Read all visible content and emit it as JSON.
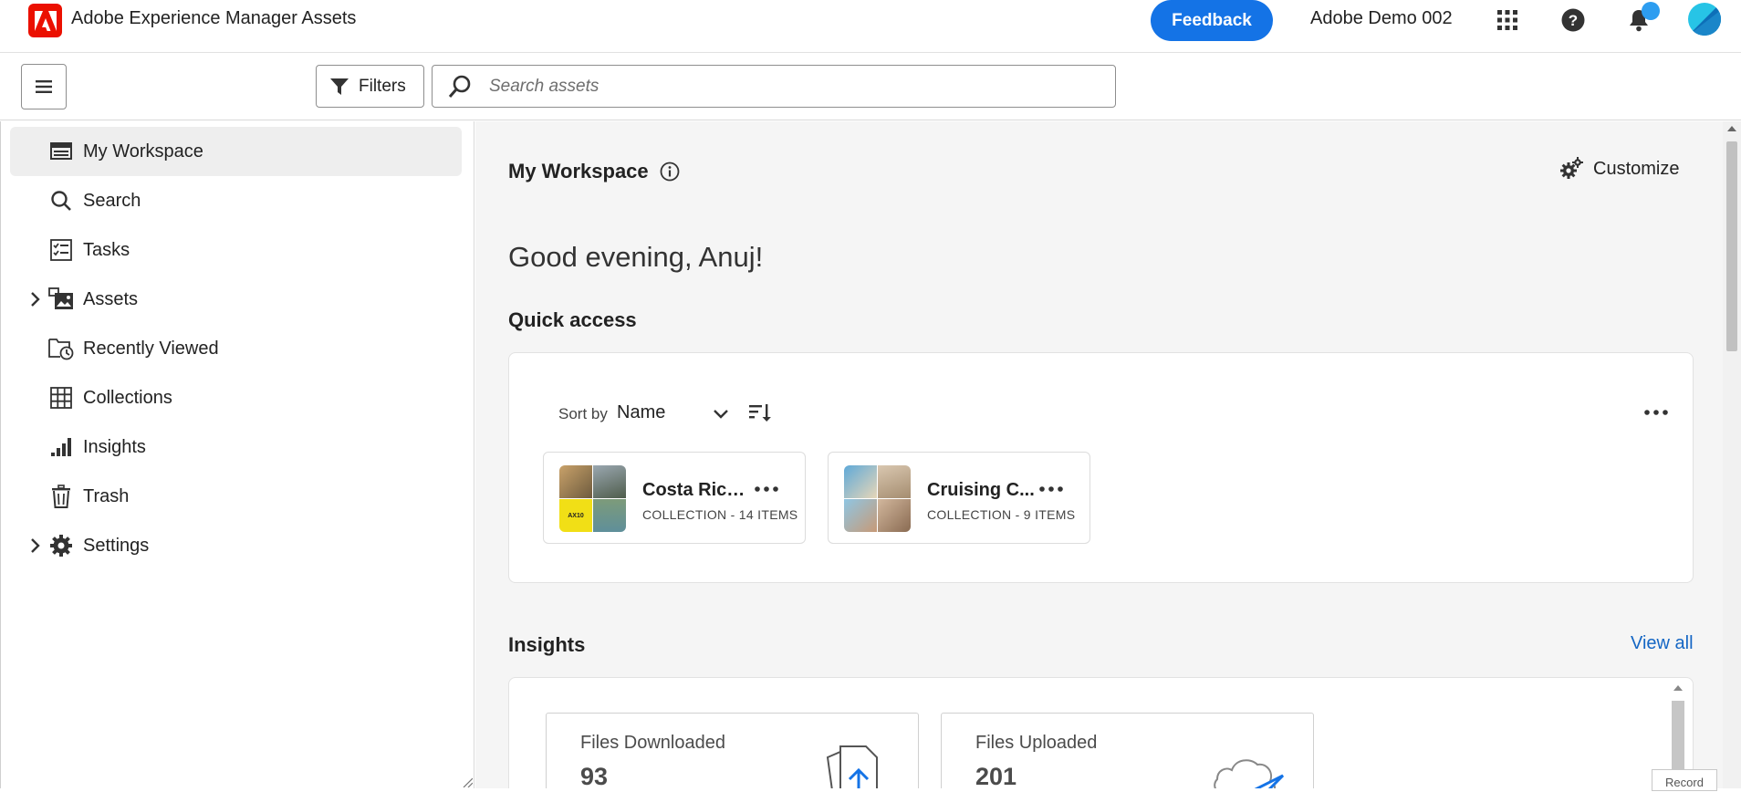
{
  "header": {
    "app_title": "Adobe Experience Manager Assets",
    "feedback_label": "Feedback",
    "org_name": "Adobe Demo 002",
    "icons": [
      "app-switcher-icon",
      "help-icon",
      "bell-icon"
    ]
  },
  "toolbar": {
    "filters_label": "Filters",
    "search_placeholder": "Search assets"
  },
  "sidebar": {
    "items": [
      {
        "label": "My Workspace",
        "icon": "workspace-icon",
        "active": true
      },
      {
        "label": "Search",
        "icon": "search-icon"
      },
      {
        "label": "Tasks",
        "icon": "tasks-icon"
      },
      {
        "label": "Assets",
        "icon": "assets-icon",
        "expandable": true
      },
      {
        "label": "Recently Viewed",
        "icon": "recently-viewed-icon"
      },
      {
        "label": "Collections",
        "icon": "collections-icon"
      },
      {
        "label": "Insights",
        "icon": "insights-icon"
      },
      {
        "label": "Trash",
        "icon": "trash-icon"
      },
      {
        "label": "Settings",
        "icon": "gear-icon",
        "expandable": true
      }
    ]
  },
  "main": {
    "title": "My Workspace",
    "customize_label": "Customize",
    "greeting": "Good evening, Anuj!",
    "quick_access": {
      "title": "Quick access",
      "sort_by_label": "Sort by",
      "sort_value": "Name",
      "collections": [
        {
          "name": "Costa Rica...",
          "meta": "COLLECTION - 14 ITEMS"
        },
        {
          "name": "Cruising C...",
          "meta": "COLLECTION - 9 ITEMS"
        }
      ]
    },
    "insights": {
      "title": "Insights",
      "view_all": "View all",
      "stats": [
        {
          "label": "Files Downloaded",
          "value": "93"
        },
        {
          "label": "Files Uploaded",
          "value": "201"
        }
      ]
    },
    "record_chip": "Record"
  },
  "colors": {
    "brand_red": "#eb1000",
    "accent_blue": "#1473e6",
    "link_blue": "#1466c4"
  }
}
